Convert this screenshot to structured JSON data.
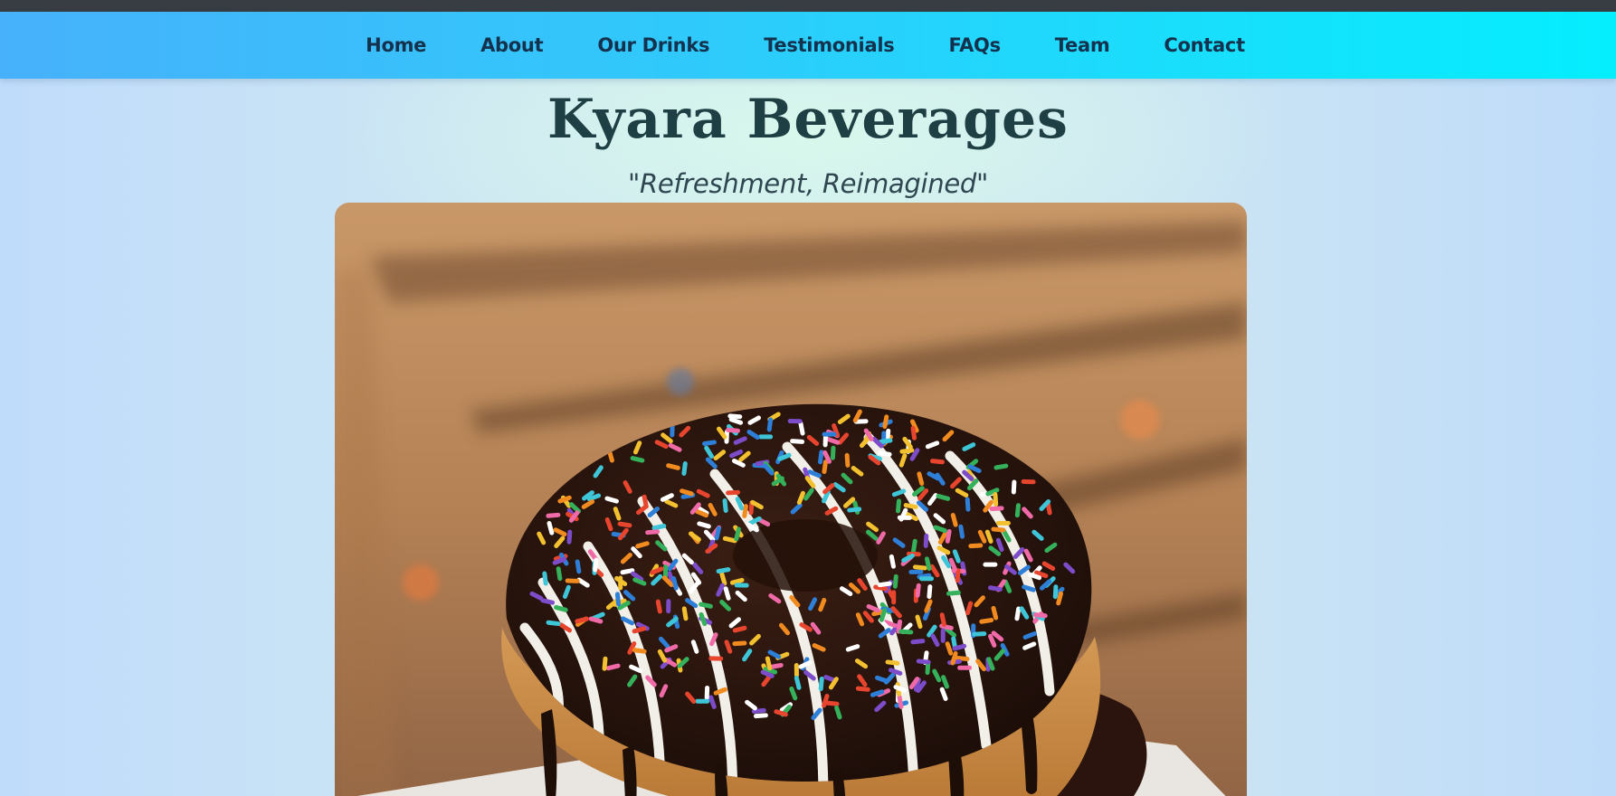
{
  "nav": {
    "items": [
      {
        "label": "Home"
      },
      {
        "label": "About"
      },
      {
        "label": "Our Drinks"
      },
      {
        "label": "Testimonials"
      },
      {
        "label": "FAQs"
      },
      {
        "label": "Team"
      },
      {
        "label": "Contact"
      }
    ]
  },
  "hero": {
    "title": "Kyara Beverages",
    "tagline": "\"Refreshment, Reimagined\"",
    "image": "donut-sprinkles-photo"
  },
  "colors": {
    "nav_gradient_start": "#47b1fb",
    "nav_gradient_end": "#04eefe",
    "nav_text": "#14324d",
    "title_text": "#1e3f44",
    "top_strip": "#373d42"
  }
}
